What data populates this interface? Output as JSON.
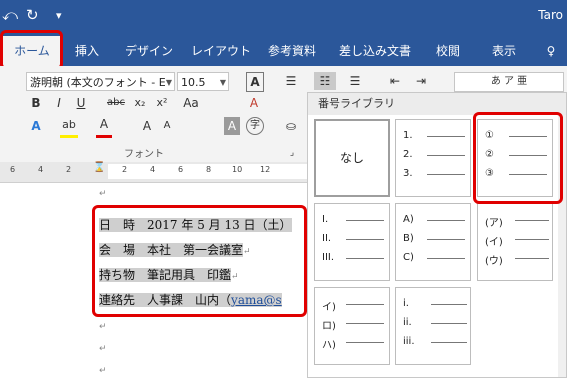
{
  "titlebar": {
    "title": "Taro",
    "undo_icon": "undo-icon",
    "redo_icon": "redo-icon",
    "customize_icon": "customize-qat-icon"
  },
  "tabs": [
    "ホーム",
    "挿入",
    "デザイン",
    "レイアウト",
    "参考資料",
    "差し込み文書",
    "校閲",
    "表示"
  ],
  "tell_me_icon": "lightbulb-icon",
  "ribbon": {
    "font_name": "游明朝 (本文のフォント - E",
    "font_size": "10.5",
    "font_group_label": "フォント",
    "size_up": "A",
    "size_down": "A",
    "aa": "Aa",
    "clear_format": "A",
    "bold": "B",
    "italic": "I",
    "underline": "U",
    "strike": "abc",
    "subscript": "x₂",
    "superscript": "x²",
    "text_effect": "A",
    "highlight": "ab",
    "font_color": "A",
    "grow": "A",
    "shrink": "A",
    "char_shading": "A",
    "enclosed": "字",
    "gallery_partial": "あ ア 亜"
  },
  "ruler_numbers": [
    "6",
    "4",
    "2",
    "2",
    "4",
    "6",
    "8",
    "10",
    "12"
  ],
  "document": {
    "lines": [
      {
        "label": "日　時",
        "value": "2017 年 5 月 13 日（土）"
      },
      {
        "label": "会　場",
        "value": "本社　第一会議室"
      },
      {
        "label": "持ち物",
        "value": "筆記用具　印鑑"
      },
      {
        "label": "連絡先",
        "value": "人事課　山内（",
        "link": "yama@s"
      }
    ],
    "return_mark": "↵"
  },
  "numbering_dropdown": {
    "header": "番号ライブラリ",
    "none_label": "なし",
    "formats": [
      [
        "1.",
        "2.",
        "3."
      ],
      [
        "①",
        "②",
        "③"
      ],
      [
        "I.",
        "II.",
        "III."
      ],
      [
        "A)",
        "B)",
        "C)"
      ],
      [
        "(ア)",
        "(イ)",
        "(ウ)"
      ],
      [
        "イ)",
        "ロ)",
        "ハ)"
      ],
      [
        "i.",
        "ii.",
        "iii."
      ]
    ]
  },
  "colors": {
    "brand": "#2b579a",
    "highlight_red": "#e00000",
    "selection_gray": "#cfcfcf"
  }
}
